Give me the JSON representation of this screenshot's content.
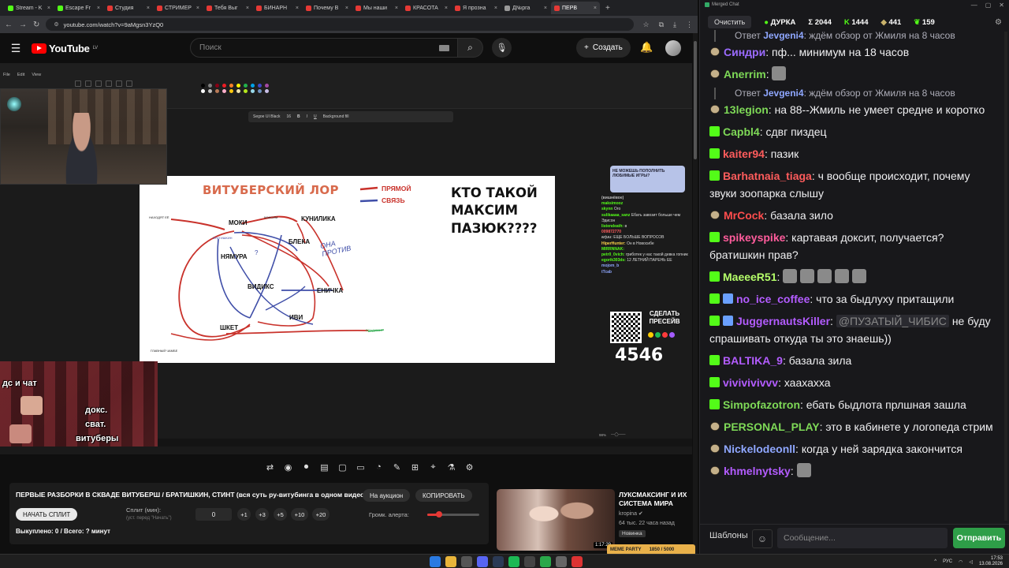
{
  "browser": {
    "tabs": [
      {
        "label": "Stream - K",
        "color": "#53fc18"
      },
      {
        "label": "Escape Fr",
        "color": "#53fc18"
      },
      {
        "label": "Студия",
        "color": "#e53935"
      },
      {
        "label": "СТРИМЕР",
        "color": "#e53935"
      },
      {
        "label": "Тебя Выг",
        "color": "#e53935"
      },
      {
        "label": "БИНАРН",
        "color": "#e53935"
      },
      {
        "label": "Почему В",
        "color": "#e53935"
      },
      {
        "label": "Мы наши",
        "color": "#e53935"
      },
      {
        "label": "КРАСОТА",
        "color": "#e53935"
      },
      {
        "label": "Я прозна",
        "color": "#e53935"
      },
      {
        "label": "Д№рга",
        "color": "#999999"
      },
      {
        "label": "ПЕРВ",
        "color": "#e53935",
        "active": true
      }
    ],
    "url": "youtube.com/watch?v=9aMgsn3YzQ0"
  },
  "youtube": {
    "logo": "YouTube",
    "region": "LV",
    "search_placeholder": "Поиск",
    "create_label": "Создать"
  },
  "paint": {
    "menu": [
      "File",
      "Edit",
      "View"
    ],
    "font": "Segoe UI Black",
    "size": "16",
    "bg_fill": "Background fill",
    "zoom": "98%"
  },
  "whiteboard": {
    "title": "ВИТУБЕРСКИЙ ЛОР",
    "legend_direct": "ПРЯМОЙ",
    "legend_link": "СВЯЗЬ",
    "question": "КТО ТАКОЙ МАКСИМ ПАЗЮК????",
    "nodes": {
      "moki": "МОКИ",
      "kunilika": "КУНИЛИКА",
      "bleka": "БЛЕКА",
      "nyamura": "НЯМУРА",
      "vidiks": "ВИДИКС",
      "enichka": "ЕНИЧКА",
      "ivi": "ИВИ",
      "shket": "ШКЕТ"
    },
    "handwritten": "ОНА ПРОТИВ",
    "small": {
      "nakhodyat": "НАХОДЯТ ЕЁ",
      "bratishkin": "БРАТИШКИН",
      "maksim": "МАКСИМ",
      "vladimir": "ВЛАДИМИР",
      "glavny": "ГЛАВНЫЙ ЧАМБЕ"
    }
  },
  "cam2": {
    "line1": "дс и чат",
    "line2": "докс.",
    "line3": "сват.",
    "line4": "витуберы"
  },
  "overlay": {
    "banner": "НЕ МОЖЕШЬ ПОПОЛНИТЬ ЛЮБИМЫЕ ИГРЫ?",
    "chat": [
      {
        "u": "(вишнёвое)",
        "t": "",
        "c": "#bbbbbb"
      },
      {
        "u": "maksimooz",
        "t": "",
        "c": "#53fc18"
      },
      {
        "u": "skynn",
        "t": "Ого",
        "c": "#53fc18"
      },
      {
        "u": "sulikaaaa_sanz",
        "t": "Ебать завозит больше чем Эдисон",
        "c": "#53fc18"
      },
      {
        "u": "listendeath:",
        "t": "в",
        "c": "#53fc18"
      },
      {
        "u": "009872770",
        "t": "",
        "c": "#ff5c5c"
      },
      {
        "u": "arjuu:",
        "t": "ЕЩЕ БОЛЬШЕ ВОПРОСОВ",
        "c": "#bbbbbb"
      },
      {
        "u": "HiperHunter:",
        "t": "Он в Новосибе",
        "c": "#ffd54a"
      },
      {
        "u": "MIRRNNAK:",
        "t": "",
        "c": "#53fc18"
      },
      {
        "u": "petr0_0vich:",
        "t": "гриботек у нас такой девка гопник",
        "c": "#53fc18"
      },
      {
        "u": "egorik303ds:",
        "t": "12 ЛЕТНИЙ ПАРЕНЬ ЕЕ",
        "c": "#53fc18"
      },
      {
        "u": "mojom_b",
        "t": "",
        "c": "#8fa7ff"
      },
      {
        "u": "tTcab",
        "t": "",
        "c": "#8fa7ff"
      }
    ],
    "qr_label": "СДЕЛАТЬ ПРЕСЕЙВ",
    "count": "4546"
  },
  "panel": {
    "title": "ПЕРВЫЕ РАЗБОРКИ В СКВАДЕ ВИТУБЕРШ / БРАТИШКИН, СТИНТ (вся суть ру-витубинга в одном видео)",
    "auction": "На аукцион",
    "copy": "КОПИРОВАТЬ",
    "start_split": "НАЧАТЬ СПЛИТ",
    "split_label": "Сплит (мин):",
    "split_sub": "(уст. перед \"Начать\")",
    "split_value": "0",
    "increments": [
      "+1",
      "+3",
      "+5",
      "+10",
      "+20"
    ],
    "volume_label": "Громк. алерта:",
    "volume_level": 0.22,
    "stats": "Выкуплено: 0 / Всего: ? минут"
  },
  "recommended": {
    "title": "ЛУКСМАКСИНГ И ИХ СИСТЕМА МИРА",
    "channel": "kropina",
    "meta": "64 тыс.  22 часа назад",
    "badge": "Новинка",
    "duration": "1:17:29"
  },
  "meme_party": {
    "label": "MEME PARTY",
    "progress": "1850 / 5000"
  },
  "chat": {
    "window_title": "Merged Chat",
    "clear": "Очистить",
    "stats": [
      {
        "icon": "dot",
        "value": "ДУРКА"
      },
      {
        "icon": "sigma",
        "value": "Σ 2044"
      },
      {
        "icon": "kick",
        "value": "1444"
      },
      {
        "icon": "twitch",
        "value": "441"
      },
      {
        "icon": "vk",
        "value": "159"
      }
    ],
    "messages": [
      {
        "type": "reply",
        "text": "Ответ ",
        "who": "Jevgeni4",
        "rest": ": ждём обзор от Жмиля на 8 часов"
      },
      {
        "badge": "b",
        "user": "Синдри",
        "color": "#9b6bff",
        "text": "пф... минимум на 18 часов"
      },
      {
        "badge": "b",
        "user": "Anerrim",
        "color": "#7ed957",
        "text": "",
        "emote": true
      },
      {
        "type": "reply",
        "text": "Ответ ",
        "who": "Jevgeni4",
        "rest": ": ждём обзор от Жмиля на 8 часов"
      },
      {
        "badge": "b",
        "user": "13legion",
        "color": "#7ed957",
        "text": "на 88--Жмиль не умеет средне и коротко"
      },
      {
        "badge": "k",
        "user": "Capbl4",
        "color": "#7ed957",
        "text": "сдвг пиздец"
      },
      {
        "badge": "k",
        "user": "kaiter94",
        "color": "#ff5c5c",
        "text": "пазик"
      },
      {
        "badge": "k",
        "user": "Barhatnaia_tiaga",
        "color": "#ff5c5c",
        "text": "ч вообще происходит, почему звуки зоопарка слышу"
      },
      {
        "badge": "b",
        "user": "MrCock",
        "color": "#ff4d4d",
        "text": "базала зило"
      },
      {
        "badge": "k",
        "user": "spikeyspike",
        "color": "#ff5c9c",
        "text": "картавая доксит, получается? братишкин прав?"
      },
      {
        "badge": "k",
        "user": "MaeeeR51",
        "color": "#b5ff6a",
        "text": "",
        "emotes": 5
      },
      {
        "badge": "k",
        "badge2": "x",
        "user": "no_ice_coffee",
        "color": "#b35cff",
        "text": "что за быдлуху притащили"
      },
      {
        "badge": "k",
        "badge2": "x",
        "user": "JuggernautsKiller",
        "color": "#b35cff",
        "mention": "@ПУЗАТЫЙ_ЧИБИС",
        "text": "не буду спрашивать откуда ты это знаешь))"
      },
      {
        "badge": "k",
        "user": "BALTIKA_9",
        "color": "#b35cff",
        "text": "базала зила"
      },
      {
        "badge": "k",
        "user": "vivivivivvv",
        "color": "#b35cff",
        "text": "хаахахха"
      },
      {
        "badge": "k",
        "user": "Simpofazotron",
        "color": "#7ed957",
        "text": "ебать быдлота прлшная зашла"
      },
      {
        "badge": "b",
        "user": "PERSONAL_PLAY",
        "color": "#7ed957",
        "text": "это в кабинете у логопеда стрим"
      },
      {
        "badge": "b",
        "user": "Nickelodeonll",
        "color": "#8fa7ff",
        "text": "когда у ней зарядка закончится"
      },
      {
        "badge": "b",
        "user": "khmelnytsky",
        "color": "#b35cff",
        "text": "",
        "emote": true
      }
    ],
    "templates": "Шаблоны",
    "input_placeholder": "Сообщение...",
    "send": "Отправить"
  },
  "taskbar": {
    "lang": "РУС",
    "time": "17:53",
    "date": "13.08.2026"
  }
}
